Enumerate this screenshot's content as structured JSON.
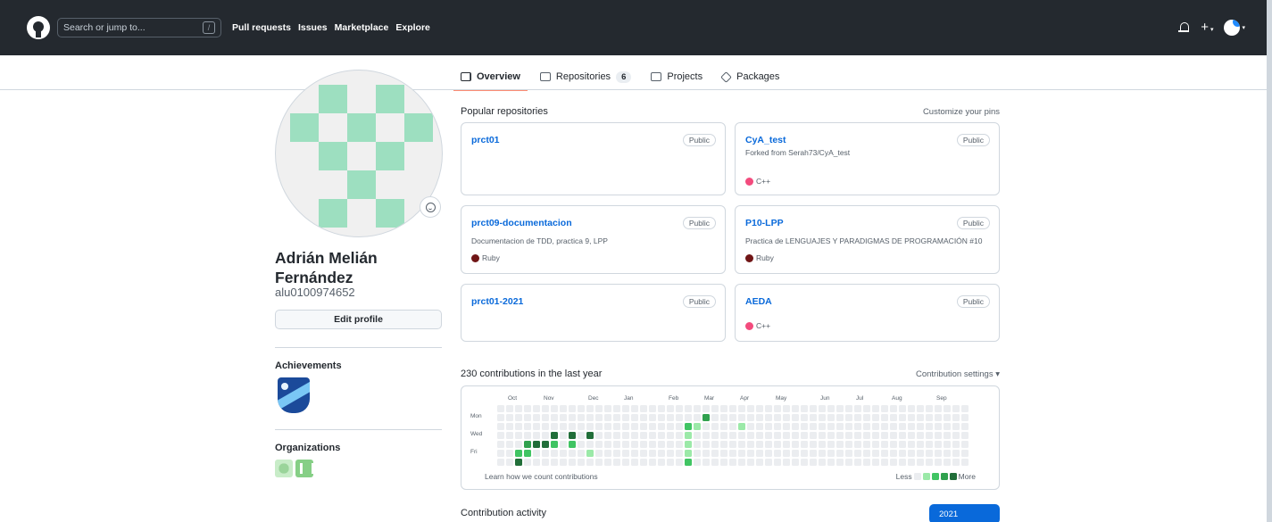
{
  "header": {
    "search_placeholder": "Search or jump to...",
    "slash_key": "/",
    "nav": [
      "Pull requests",
      "Issues",
      "Marketplace",
      "Explore"
    ],
    "plus": "+",
    "caret": "▾"
  },
  "tabs": [
    {
      "label": "Overview",
      "active": true
    },
    {
      "label": "Repositories",
      "count": "6"
    },
    {
      "label": "Projects"
    },
    {
      "label": "Packages"
    }
  ],
  "profile": {
    "name_line1": "Adrián Melián",
    "name_line2": "Fernández",
    "login": "alu0100974652",
    "edit_label": "Edit profile",
    "achievements_label": "Achievements",
    "organizations_label": "Organizations"
  },
  "popular": {
    "title": "Popular repositories",
    "customize": "Customize your pins",
    "repos": [
      {
        "name": "prct01",
        "visibility": "Public",
        "sub": "",
        "desc": "",
        "lang": "",
        "lang_color": ""
      },
      {
        "name": "CyA_test",
        "visibility": "Public",
        "sub": "Forked from Serah73/CyA_test",
        "desc": "",
        "lang": "C++",
        "lang_color": "#f34b7d"
      },
      {
        "name": "prct09-documentacion",
        "visibility": "Public",
        "sub": "",
        "desc": "Documentacion de TDD, practica 9, LPP",
        "lang": "Ruby",
        "lang_color": "#701516"
      },
      {
        "name": "P10-LPP",
        "visibility": "Public",
        "sub": "",
        "desc": "Practica de LENGUAJES Y PARADIGMAS DE PROGRAMACIÓN #10",
        "lang": "Ruby",
        "lang_color": "#701516"
      },
      {
        "name": "prct01-2021",
        "visibility": "Public",
        "sub": "",
        "desc": "",
        "lang": "",
        "lang_color": ""
      },
      {
        "name": "AEDA",
        "visibility": "Public",
        "sub": "",
        "desc": "",
        "lang": "C++",
        "lang_color": "#f34b7d"
      }
    ]
  },
  "contributions": {
    "title": "230 contributions in the last year",
    "settings": "Contribution settings ▾",
    "months": [
      "Oct",
      "Nov",
      "Dec",
      "Jan",
      "Feb",
      "Mar",
      "Apr",
      "May",
      "Jun",
      "Jul",
      "Aug",
      "Sep"
    ],
    "days": [
      "Mon",
      "Wed",
      "Fri"
    ],
    "learn": "Learn how we count contributions",
    "less": "Less",
    "more": "More",
    "colors": [
      "#ebedf0",
      "#9be9a8",
      "#40c463",
      "#30a14e",
      "#216e39"
    ],
    "active_cells": [
      {
        "week": 2,
        "day": 5,
        "level": 2
      },
      {
        "week": 2,
        "day": 6,
        "level": 4
      },
      {
        "week": 3,
        "day": 4,
        "level": 3
      },
      {
        "week": 3,
        "day": 5,
        "level": 2
      },
      {
        "week": 4,
        "day": 4,
        "level": 4
      },
      {
        "week": 5,
        "day": 4,
        "level": 4
      },
      {
        "week": 6,
        "day": 3,
        "level": 4
      },
      {
        "week": 6,
        "day": 4,
        "level": 2
      },
      {
        "week": 7,
        "day": 7,
        "level": 4
      },
      {
        "week": 8,
        "day": 3,
        "level": 4
      },
      {
        "week": 8,
        "day": 4,
        "level": 2
      },
      {
        "week": 10,
        "day": 3,
        "level": 4
      },
      {
        "week": 10,
        "day": 5,
        "level": 1
      },
      {
        "week": 20,
        "day": 7,
        "level": 4
      },
      {
        "week": 21,
        "day": 2,
        "level": 2
      },
      {
        "week": 21,
        "day": 3,
        "level": 1
      },
      {
        "week": 21,
        "day": 4,
        "level": 1
      },
      {
        "week": 21,
        "day": 5,
        "level": 1
      },
      {
        "week": 21,
        "day": 6,
        "level": 2
      },
      {
        "week": 21,
        "day": 7,
        "level": 2
      },
      {
        "week": 22,
        "day": 2,
        "level": 1
      },
      {
        "week": 22,
        "day": 7,
        "level": 1
      },
      {
        "week": 23,
        "day": 1,
        "level": 3
      },
      {
        "week": 27,
        "day": 2,
        "level": 1
      },
      {
        "week": 28,
        "day": 7,
        "level": 1
      }
    ]
  },
  "activity": {
    "title": "Contribution activity",
    "year": "2021"
  }
}
